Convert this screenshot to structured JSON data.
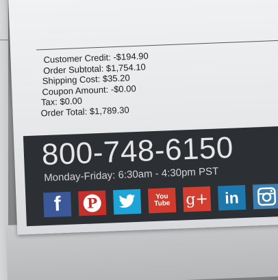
{
  "summary": {
    "customer_credit": "Customer Credit: -$194.90",
    "order_subtotal": "Order Subtotal: $1,754.10",
    "shipping_cost": "Shipping Cost: $35.20",
    "coupon_amount": "Coupon Amount: -$0.00",
    "tax": "Tax: $0.00",
    "order_total": "Order Total: $1,789.30"
  },
  "contact": {
    "phone": "800-748-6150",
    "hours": "Monday-Friday: 6:30am - 4:30pm PST"
  },
  "social": [
    {
      "icon": "facebook-icon",
      "glyph": "f",
      "color": "#3b5998"
    },
    {
      "icon": "pinterest-icon",
      "glyph": "P",
      "color": "#c4302b"
    },
    {
      "icon": "twitter-icon",
      "glyph": "bird",
      "color": "#1fa4d8"
    },
    {
      "icon": "youtube-icon",
      "glyph_top": "You",
      "glyph_bottom": "Tube",
      "color": "#d13b2e"
    },
    {
      "icon": "google-plus-icon",
      "glyph": "g+",
      "color": "#d23f31"
    },
    {
      "icon": "linkedin-icon",
      "glyph": "in",
      "color": "#1c78ad"
    },
    {
      "icon": "instagram-icon",
      "glyph": "camera",
      "color": "#3a7fb0"
    }
  ],
  "banner_color": "#2c2f33"
}
